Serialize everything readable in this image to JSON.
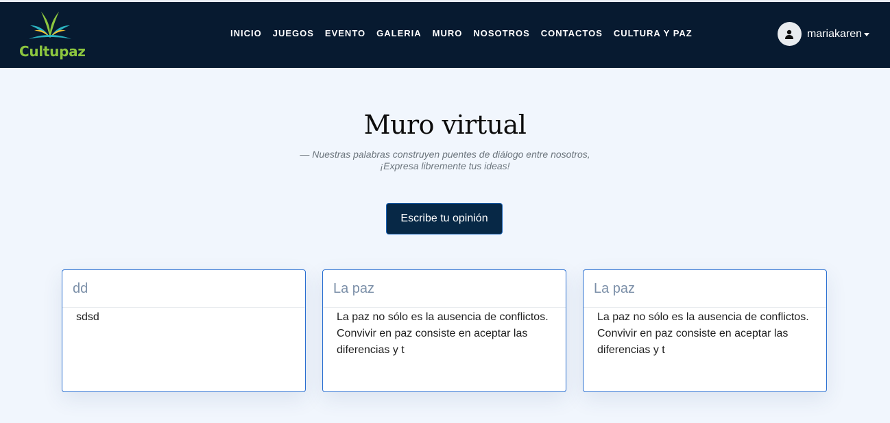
{
  "brand": {
    "name": "Cultupaz",
    "logo_colors": [
      "#8cc63f",
      "#2bb3c0",
      "#f2c230"
    ]
  },
  "nav": {
    "links": [
      {
        "label": "INICIO"
      },
      {
        "label": "JUEGOS"
      },
      {
        "label": "EVENTO"
      },
      {
        "label": "GALERIA"
      },
      {
        "label": "MURO"
      },
      {
        "label": "NOSOTROS"
      },
      {
        "label": "CONTACTOS"
      },
      {
        "label": "CULTURA Y PAZ"
      }
    ],
    "user": {
      "name": "mariakaren",
      "icon": "user-icon"
    }
  },
  "main": {
    "title": "Muro virtual",
    "subtitle_line1": "—  Nuestras palabras construyen puentes de diálogo entre nosotros,",
    "subtitle_line2": "¡Expresa libremente tus ideas!",
    "cta_label": "Escribe tu opinión"
  },
  "posts": [
    {
      "title": "dd",
      "body": "sdsd"
    },
    {
      "title": "La paz",
      "body": "La paz no sólo es la ausencia de conflictos. Convivir en paz consiste en aceptar las diferencias y t"
    },
    {
      "title": "La paz",
      "body": "La paz no sólo es la ausencia de conflictos. Convivir en paz consiste en aceptar las diferencias y t"
    }
  ],
  "colors": {
    "navbar": "#071a30",
    "page_bg": "#f1f6fd",
    "button_bg": "#072846",
    "card_border": "#2a6fd1",
    "card_title": "#7b8fa8"
  }
}
